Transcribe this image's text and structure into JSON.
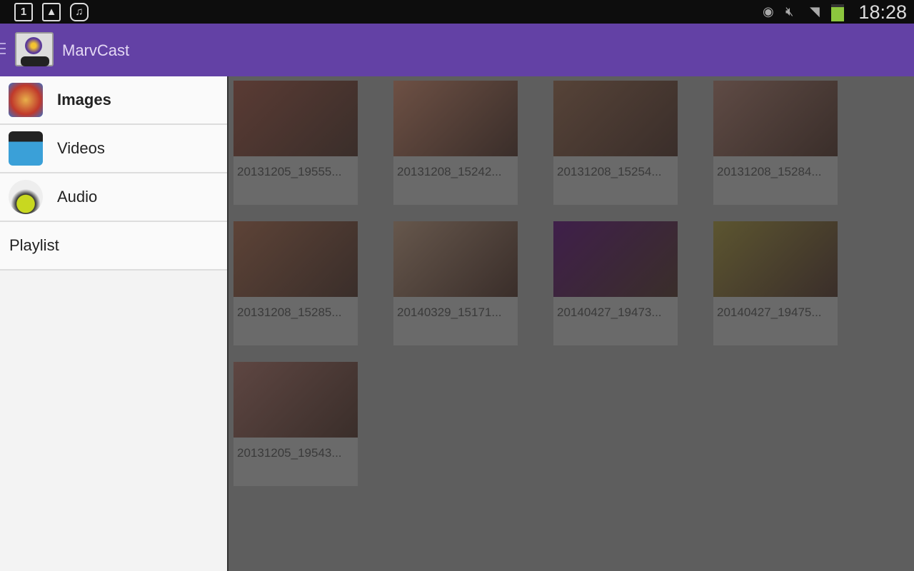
{
  "status_bar": {
    "time": "18:28",
    "left_icons": [
      "notification-1-icon",
      "gallery-icon",
      "marvcast-icon"
    ],
    "right_icons": [
      "eye-icon",
      "mute-icon",
      "wifi-icon",
      "battery-icon"
    ],
    "battery_color": "#8cc63e"
  },
  "app_bar": {
    "title": "MarvCast",
    "color": "#6341a5"
  },
  "sidebar": {
    "items": [
      {
        "label": "Images",
        "icon": "palette-icon",
        "active": true
      },
      {
        "label": "Videos",
        "icon": "clapperboard-icon"
      },
      {
        "label": "Audio",
        "icon": "headphones-icon"
      },
      {
        "label": "Playlist"
      }
    ]
  },
  "grid": {
    "items": [
      {
        "name": "20131205_19555...",
        "tint": "#5a3b34"
      },
      {
        "name": "20131208_15242...",
        "tint": "#6d5044"
      },
      {
        "name": "20131208_15254...",
        "tint": "#564338"
      },
      {
        "name": "20131208_15284...",
        "tint": "#5f4b45"
      },
      {
        "name": "20131208_15285...",
        "tint": "#5d4337"
      },
      {
        "name": "20140329_15171...",
        "tint": "#66574c"
      },
      {
        "name": "20140427_19473...",
        "tint": "#3f1f4a"
      },
      {
        "name": "20140427_19475...",
        "tint": "#5c5530"
      },
      {
        "name": "20131205_19543...",
        "tint": "#5e4642"
      }
    ]
  }
}
